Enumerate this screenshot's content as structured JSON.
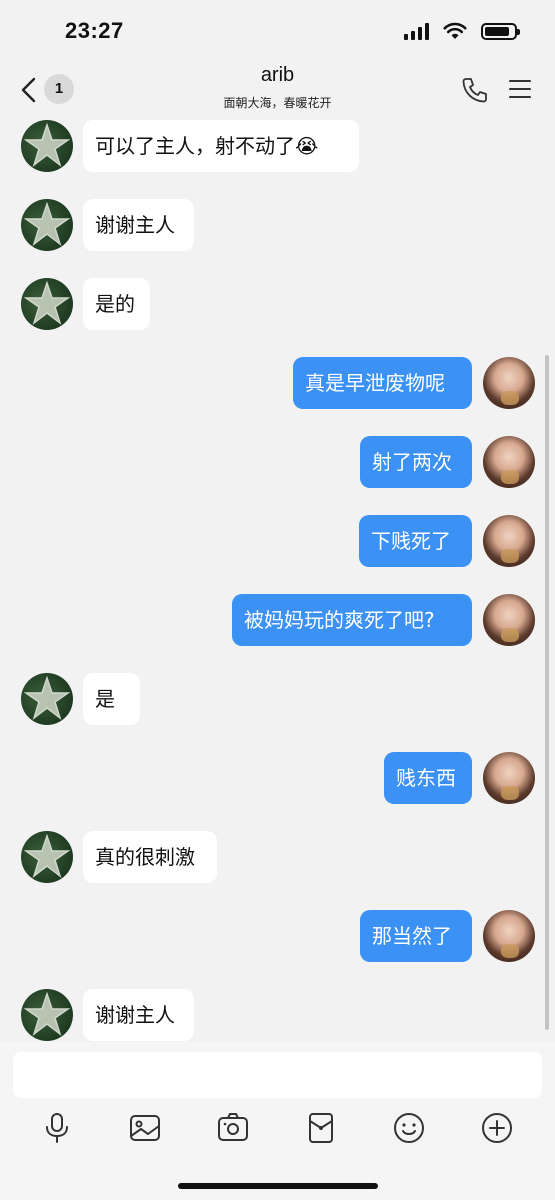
{
  "status_bar": {
    "time": "23:27"
  },
  "header": {
    "unread_count": "1",
    "title": "arib",
    "subtitle": "面朝大海，春暖花开"
  },
  "messages": [
    {
      "side": "in",
      "text": "可以了主人，射不动了😭"
    },
    {
      "side": "in",
      "text": "谢谢主人"
    },
    {
      "side": "in",
      "text": "是的"
    },
    {
      "side": "out",
      "text": "真是早泄废物呢"
    },
    {
      "side": "out",
      "text": "射了两次"
    },
    {
      "side": "out",
      "text": "下贱死了"
    },
    {
      "side": "out",
      "text": "被妈妈玩的爽死了吧?"
    },
    {
      "side": "in",
      "text": "是"
    },
    {
      "side": "out",
      "text": "贱东西"
    },
    {
      "side": "in",
      "text": "真的很刺激"
    },
    {
      "side": "out",
      "text": "那当然了"
    },
    {
      "side": "in",
      "text": "谢谢主人"
    }
  ],
  "input": {
    "value": ""
  },
  "toolbar": {
    "icons": [
      "microphone-icon",
      "image-icon",
      "camera-icon",
      "red-packet-icon",
      "emoji-icon",
      "plus-icon"
    ]
  },
  "colors": {
    "outgoing_bubble": "#3c91f5",
    "incoming_bubble": "#ffffff",
    "background": "#f2f2f2"
  }
}
